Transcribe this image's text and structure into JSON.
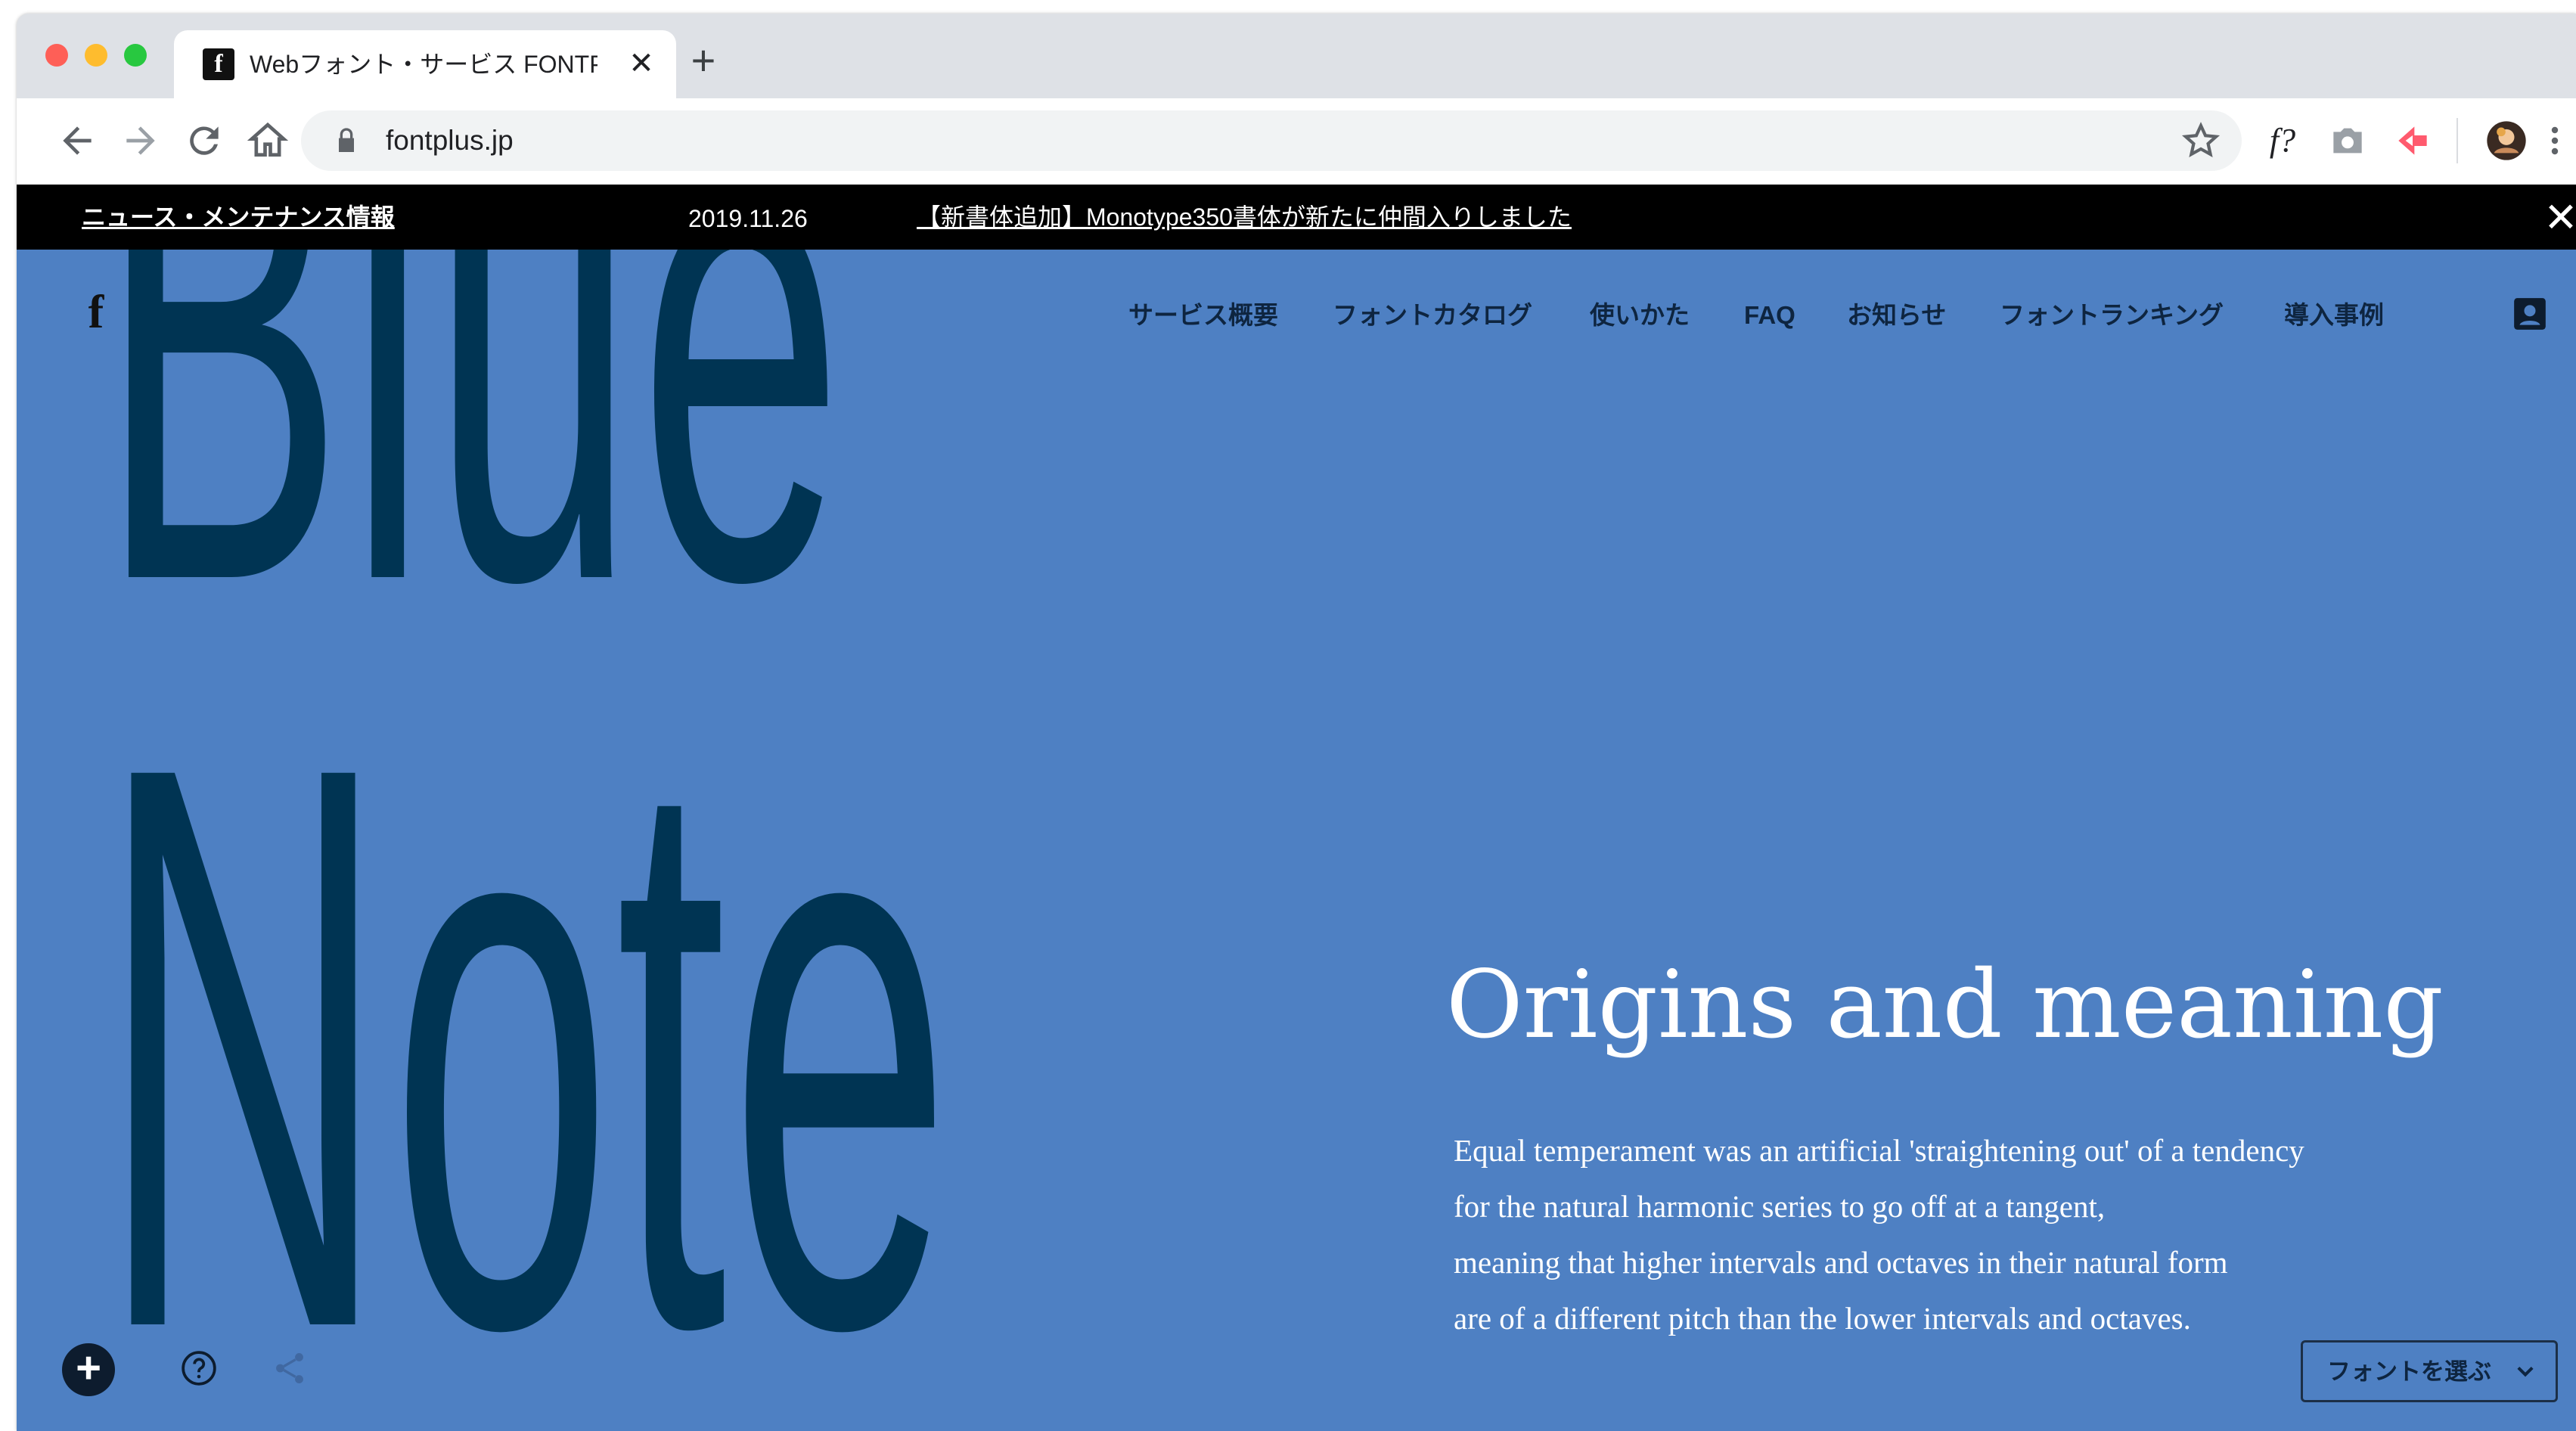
{
  "browser": {
    "tab": {
      "title": "Webフォント・サービス FONTPLUS",
      "favicon_glyph": "f",
      "close_glyph": "✕"
    },
    "new_tab_glyph": "+",
    "toolbar": {
      "back_icon": "back-arrow-icon",
      "forward_icon": "forward-arrow-icon",
      "reload_icon": "reload-icon",
      "home_icon": "home-icon",
      "url": "fontplus.jp",
      "extensions": [
        "font-question-icon",
        "camera-icon",
        "red-arrow-extension-icon",
        "profile-avatar",
        "more-vert-icon"
      ],
      "font_ext_label": "f?"
    }
  },
  "news_bar": {
    "label": "ニュース・メンテナンス情報",
    "date": "2019.11.26",
    "headline": "【新書体追加】Monotype350書体が新たに仲間入りしました",
    "close_glyph": "✕"
  },
  "site": {
    "logo_glyph": "f",
    "nav": [
      {
        "label": "サービス概要"
      },
      {
        "label": "フォントカタログ"
      },
      {
        "label": "使いかた"
      },
      {
        "label": "FAQ"
      },
      {
        "label": "お知らせ"
      },
      {
        "label": "フォントランキング"
      },
      {
        "label": "導入事例"
      }
    ]
  },
  "hero": {
    "word1": "Blue",
    "word2": "Note"
  },
  "article": {
    "heading": "Origins and meaning",
    "lines": [
      "Equal temperament was an artificial 'straightening out' of a tendency",
      "for the natural harmonic series to go off at a tangent,",
      "meaning that higher intervals and octaves in their natural form",
      "are of a different pitch than the lower intervals and octaves."
    ]
  },
  "controls": {
    "add_glyph": "+",
    "font_select_label": "フォントを選ぶ"
  },
  "colors": {
    "page_background": "#4e80c3",
    "hero_text": "#003453",
    "news_bar": "#000000",
    "nav_text": "#0e2540"
  }
}
